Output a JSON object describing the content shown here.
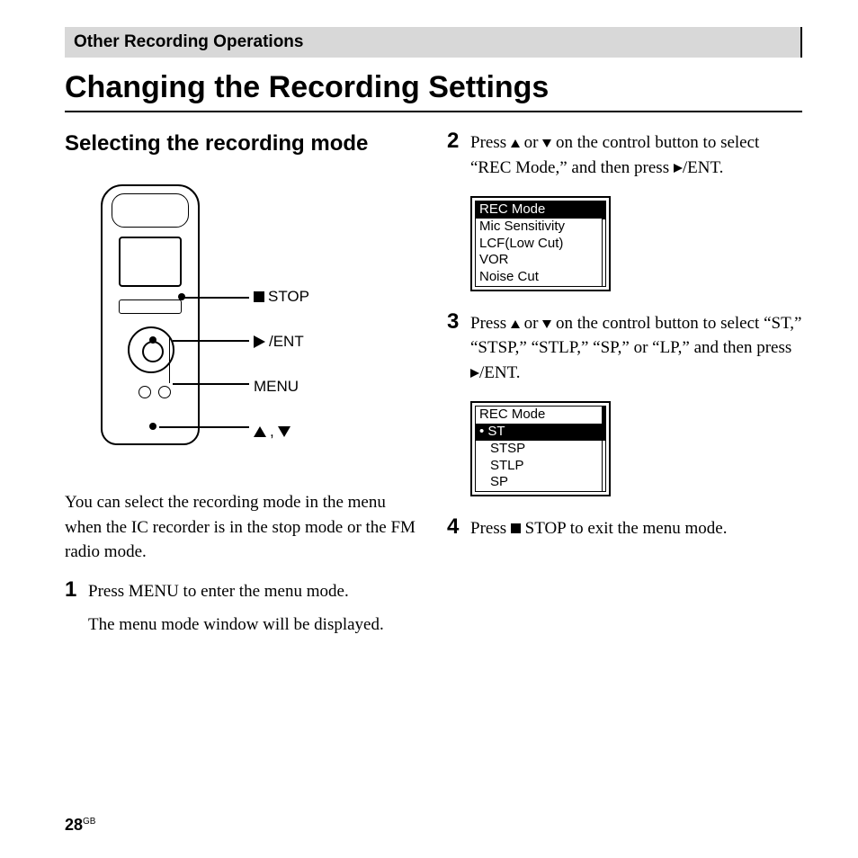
{
  "header": "Other Recording Operations",
  "title": "Changing the Recording Settings",
  "subheading": "Selecting the recording mode",
  "device_labels": {
    "stop": "STOP",
    "ent": "/ENT",
    "menu": "MENU"
  },
  "intro": "You can select the recording mode in the menu when the IC recorder is in the stop mode or the FM radio mode.",
  "steps": {
    "s1_num": "1",
    "s1_text": "Press MENU to enter the menu mode.",
    "s1_sub": "The menu mode window will be displayed.",
    "s2_num": "2",
    "s2_pre": "Press ",
    "s2_mid": " or ",
    "s2_post": " on the control button to select “REC Mode,” and then press  ",
    "s2_end": "/ENT.",
    "s3_num": "3",
    "s3_pre": "Press ",
    "s3_mid": " or ",
    "s3_post": " on the control button to select “ST,” “STSP,” “STLP,” “SP,” or “LP,” and then press ",
    "s3_end": "/ENT.",
    "s4_num": "4",
    "s4_pre": "Press ",
    "s4_post": " STOP to exit the menu mode."
  },
  "lcd1": {
    "l1": "REC Mode",
    "l2": "Mic Sensitivity",
    "l3": "LCF(Low Cut)",
    "l4": "VOR",
    "l5": "Noise Cut"
  },
  "lcd2": {
    "l1": "REC Mode",
    "l2": "ST",
    "l3": "STSP",
    "l4": "STLP",
    "l5": "SP"
  },
  "page_number": "28",
  "page_region": "GB"
}
